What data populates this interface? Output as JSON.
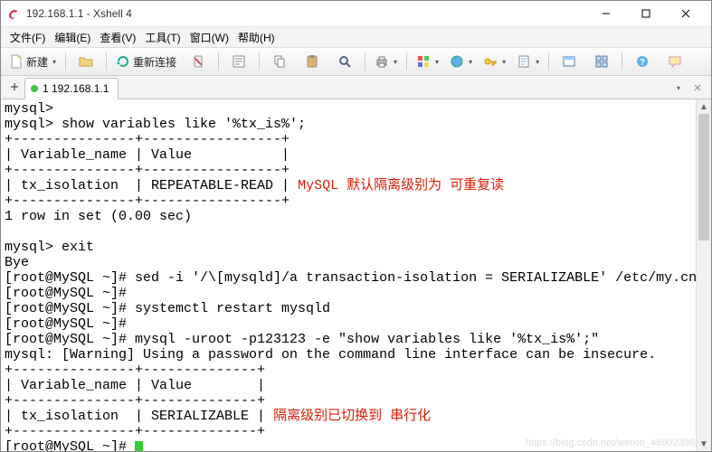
{
  "window_title": "192.168.1.1 - Xshell 4",
  "menus": {
    "file": "文件(F)",
    "edit": "编辑(E)",
    "view": "查看(V)",
    "tools": "工具(T)",
    "window": "窗口(W)",
    "help": "帮助(H)"
  },
  "toolbar": {
    "new": "新建",
    "reconnect": "重新连接"
  },
  "tab": {
    "label": "1 192.168.1.1"
  },
  "term": {
    "l1": "mysql>",
    "l2": "mysql> show variables like '%tx_is%';",
    "l3": "+---------------+-----------------+",
    "l4": "| Variable_name | Value           |",
    "l5": "+---------------+-----------------+",
    "l6a": "| tx_isolation  | REPEATABLE-READ | ",
    "l6r": "MySQL 默认隔离级别为 可重复读",
    "l7": "+---------------+-----------------+",
    "l8": "1 row in set (0.00 sec)",
    "l9": "",
    "l10": "mysql> exit",
    "l11": "Bye",
    "l12": "[root@MySQL ~]# sed -i '/\\[mysqld]/a transaction-isolation = SERIALIZABLE' /etc/my.cnf",
    "l13": "[root@MySQL ~]#",
    "l14": "[root@MySQL ~]# systemctl restart mysqld",
    "l15": "[root@MySQL ~]#",
    "l16": "[root@MySQL ~]# mysql -uroot -p123123 -e \"show variables like '%tx_is%';\"",
    "l17": "mysql: [Warning] Using a password on the command line interface can be insecure.",
    "l18": "+---------------+--------------+",
    "l19": "| Variable_name | Value        |",
    "l20": "+---------------+--------------+",
    "l21a": "| tx_isolation  | SERIALIZABLE | ",
    "l21r": "隔离级别已切换到 串行化",
    "l22": "+---------------+--------------+",
    "l23": "[root@MySQL ~]# "
  },
  "watermark": "https://blog.csdn.net/weixin_46902396"
}
